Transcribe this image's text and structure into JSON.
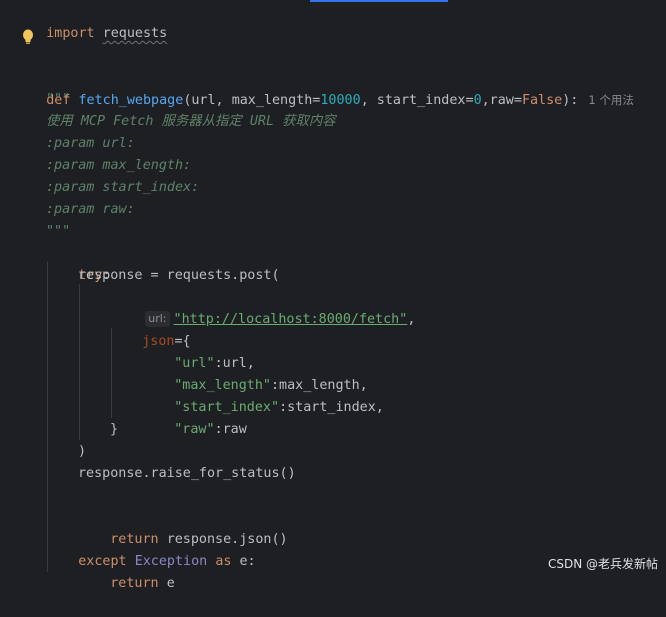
{
  "editor": {
    "lines": {
      "l1": {
        "kw": "import",
        "name": "requests"
      },
      "l2": {
        "kw": "def",
        "fn": "fetch_webpage",
        "p1": "(url, ",
        "p2": "max_length=",
        "n1": "10000",
        "p3": ", start_index=",
        "n2": "0",
        "p4": ",raw=",
        "k2": "False",
        "p5": "):",
        "usage": "1 个用法"
      },
      "l3": {
        "doc": "\"\"\""
      },
      "l4": {
        "doc": "使用 MCP Fetch 服务器从指定 URL 获取内容"
      },
      "l5": {
        "doc": ":param url:"
      },
      "l6": {
        "doc": ":param max_length:"
      },
      "l7": {
        "doc": ":param start_index:"
      },
      "l8": {
        "doc": ":param raw:"
      },
      "l9": {
        "doc": "\"\"\""
      },
      "l10": {
        "kw": "try",
        "punct": ":"
      },
      "l11": {
        "text": "response = requests.post("
      },
      "l12": {
        "hint": "url:",
        "str": "\"http://localhost:8000/fetch\"",
        "tail": ","
      },
      "l13": {
        "param": "json",
        "tail": "={"
      },
      "l14": {
        "str": "\"url\"",
        "tail": ":url,"
      },
      "l15": {
        "str": "\"max_length\"",
        "tail": ":max_length,"
      },
      "l16": {
        "str": "\"start_index\"",
        "tail": ":start_index,"
      },
      "l17": {
        "str": "\"raw\"",
        "tail": ":raw"
      },
      "l18": {
        "text": "}"
      },
      "l19": {
        "text": ")"
      },
      "l20": {
        "text": "response.raise_for_status()"
      },
      "l22": {
        "kw": "return",
        "text": "response.json()"
      },
      "l23": {
        "kw": "except",
        "builtin": "Exception",
        "kw2": "as",
        "text": "e:"
      },
      "l24": {
        "kw": "return",
        "text": "e"
      }
    }
  },
  "icons": {
    "bulb": "lightbulb-icon"
  },
  "colors": {
    "background": "#1e1f22",
    "keyword": "#cf8e6d",
    "function": "#56a8f5",
    "number": "#2aacb8",
    "string": "#6aab73",
    "docstring": "#5f826b",
    "builtin": "#8888c6",
    "param": "#aa4926"
  },
  "watermark": "CSDN @老兵发新帖"
}
